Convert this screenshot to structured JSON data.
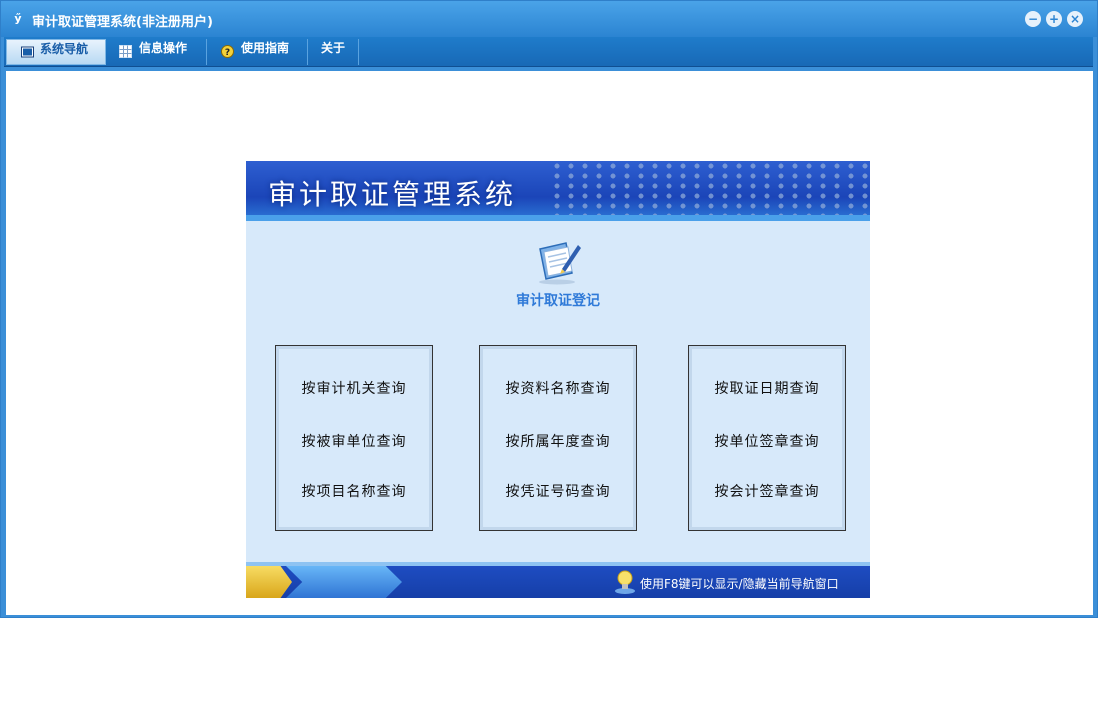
{
  "window": {
    "title": "审计取证管理系统(非注册用户)",
    "icon": "app-logo-icon",
    "controls": [
      "minimize-icon",
      "restore-icon",
      "close-icon"
    ]
  },
  "menu": {
    "tabs": [
      {
        "label": "系统导航",
        "icon": "monitor-icon",
        "active": true
      },
      {
        "label": "信息操作",
        "icon": "grid-icon",
        "active": false
      },
      {
        "label": "使用指南",
        "icon": "help-icon",
        "active": false
      },
      {
        "label": "关于",
        "icon": "",
        "active": false
      }
    ]
  },
  "panel": {
    "banner_title": "审计取证管理系统",
    "register_label": "审计取证登记",
    "query_groups": [
      [
        "按审计机关查询",
        "按被审单位查询",
        "按项目名称查询"
      ],
      [
        "按资料名称查询",
        "按所属年度查询",
        "按凭证号码查询"
      ],
      [
        "按取证日期查询",
        "按单位签章查询",
        "按会计签章查询"
      ]
    ],
    "footer_tip": "使用F8键可以显示/隐藏当前导航窗口"
  },
  "colors": {
    "accent": "#2b84d2",
    "panel_bg": "#d7e9fa",
    "banner": "#1b45b8"
  }
}
